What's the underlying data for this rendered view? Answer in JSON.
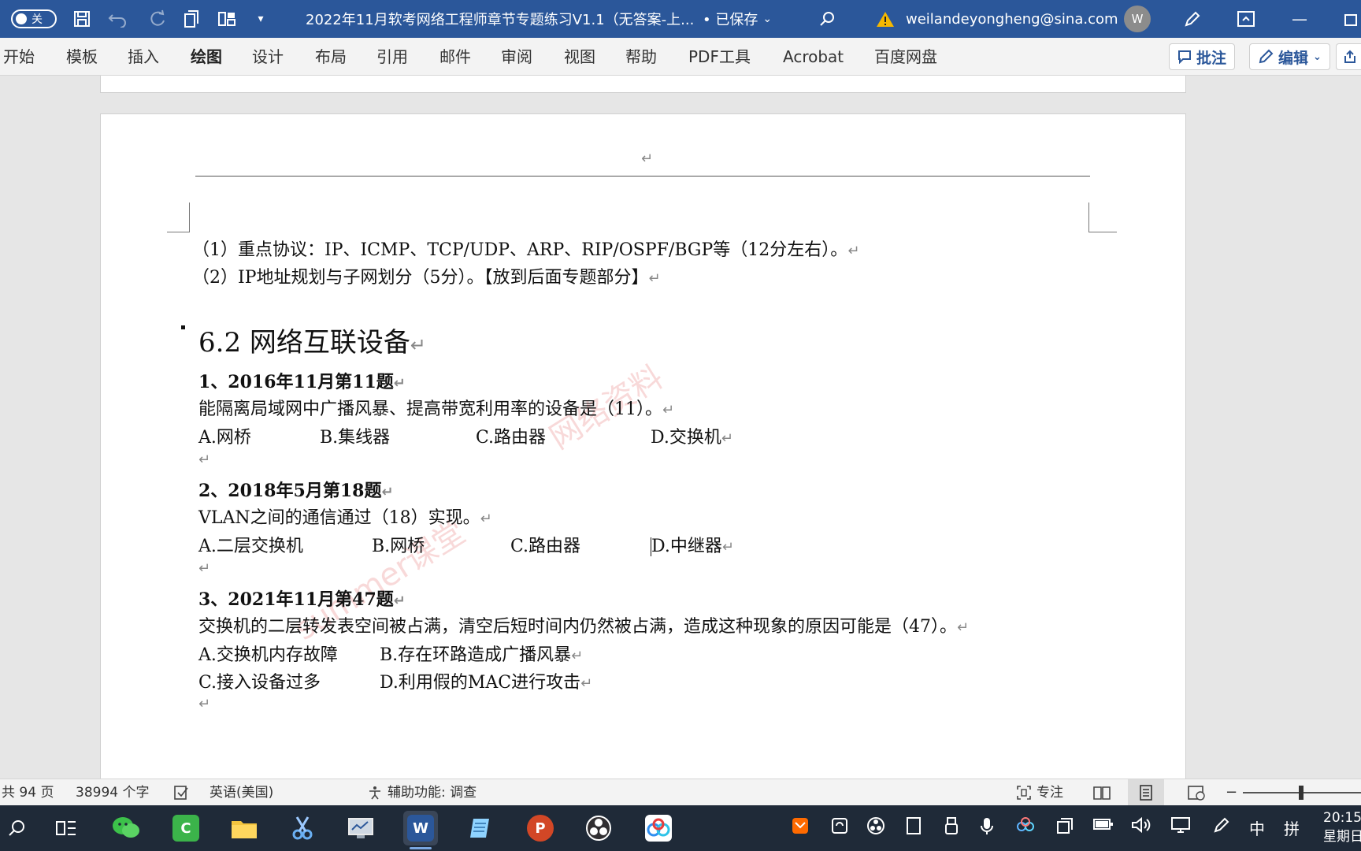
{
  "titlebar": {
    "autosave_label": "关",
    "doc_title": "2022年11月软考网络工程师章节专题练习V1.1（无答案-上...",
    "saved_status": "• 已保存",
    "account": "weilandeyongheng@sina.com",
    "avatar_letter": "W"
  },
  "ribbon": {
    "tabs": [
      "开始",
      "模板",
      "插入",
      "绘图",
      "设计",
      "布局",
      "引用",
      "邮件",
      "审阅",
      "视图",
      "帮助",
      "PDF工具",
      "Acrobat",
      "百度网盘"
    ],
    "comment_button": "批注",
    "edit_button": "编辑"
  },
  "document": {
    "lines": {
      "l1": "（1）重点协议：IP、ICMP、TCP/UDP、ARP、RIP/OSPF/BGP等（12分左右）。",
      "l2": "（2）IP地址规划与子网划分（5分）。【放到后面专题部分】",
      "heading": "6.2 网络互联设备",
      "q1_head": "1、2016年11月第11题",
      "q1_text": "能隔离局域网中广播风暴、提高带宽利用率的设备是（11）。",
      "q2_head": "2、2018年5月第18题",
      "q2_text": "VLAN之间的通信通过（18）实现。",
      "q3_head": "3、2021年11月第47题",
      "q3_text": "交换机的二层转发表空间被占满，清空后短时间内仍然被占满，造成这种现象的原因可能是（47）。"
    },
    "q1_options": [
      "A.网桥",
      "B.集线器",
      "C.路由器",
      "D.交换机"
    ],
    "q2_options": [
      "A.二层交换机",
      "B.网桥",
      "C.路由器",
      "D.中继器"
    ],
    "q3_options": [
      "A.交换机内存故障",
      "B.存在环路造成广播风暴",
      "C.接入设备过多",
      "D.利用假的MAC进行攻击"
    ],
    "para_mark": "↵",
    "watermarks": [
      "网络资料",
      "summer课堂"
    ]
  },
  "statusbar": {
    "pages": "共 94 页",
    "words": "38994 个字",
    "language": "英语(美国)",
    "accessibility": "辅助功能: 调查",
    "focus": "专注",
    "zoom_level": 0.49
  },
  "taskbar": {
    "ime_mode": "中",
    "ime_layout": "拼",
    "time": "20:15",
    "day": "星期日"
  },
  "colors": {
    "word_blue": "#2b579a",
    "taskbar": "#1f2a38"
  }
}
